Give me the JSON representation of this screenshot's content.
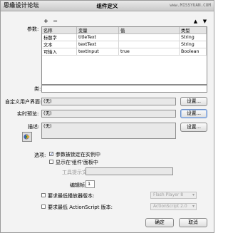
{
  "window": {
    "title": "组件定义",
    "watermark": "思缘设计论坛",
    "watermark_url": "www.MISSYUAN.COM"
  },
  "params": {
    "label": "参数:",
    "add_glyph": "+",
    "remove_glyph": "−",
    "up_glyph": "▲",
    "down_glyph": "▼",
    "columns": [
      "名称",
      "变量",
      "值",
      "类型"
    ],
    "rows": [
      [
        "标题字",
        "titleText",
        "",
        "String"
      ],
      [
        "文本",
        "textText",
        "",
        "String"
      ],
      [
        "可输入",
        "textInput",
        "true",
        "Boolean"
      ]
    ]
  },
  "class_field": {
    "label": "类:",
    "value": ""
  },
  "custom_ui": {
    "label": "自定义用户界面:",
    "value": "(无)",
    "button": "设置..."
  },
  "live_preview": {
    "label": "实时预览:",
    "value": "(无)",
    "button": "设置..."
  },
  "description": {
    "label": "描述:",
    "value": "(无)",
    "button": "设置..."
  },
  "options": {
    "label": "选项:",
    "lock_in_instance": {
      "label": "参数被锁定在实例中",
      "checked": true
    },
    "show_in_panel": {
      "label": "显示在'组件'面板中",
      "checked": false
    },
    "tooltip": {
      "label": "工具提示文",
      "value": ""
    },
    "edit_frame": {
      "label": "编辑帧:",
      "value": "1"
    }
  },
  "min_player": {
    "label": "要求最低播放器版本:",
    "value": "Flash Player 8"
  },
  "min_as": {
    "label": "要求最低 ActionScript 版本:",
    "value": "ActionScript 2.0"
  },
  "buttons": {
    "ok": "确定",
    "cancel": "取消"
  }
}
